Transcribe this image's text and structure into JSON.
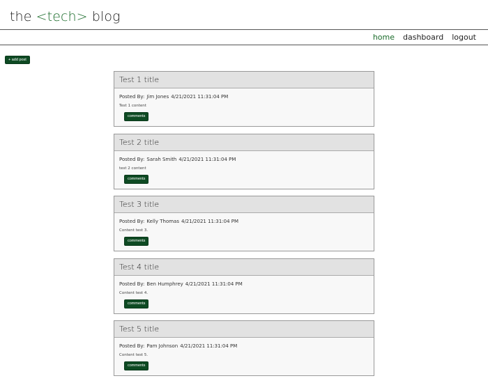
{
  "header": {
    "title_prefix": "the ",
    "title_accent": "<tech>",
    "title_suffix": " blog"
  },
  "nav": {
    "items": [
      {
        "label": "home",
        "active": true
      },
      {
        "label": "dashboard",
        "active": false
      },
      {
        "label": "logout",
        "active": false
      }
    ]
  },
  "toolbar": {
    "add_post_label": "+ add post"
  },
  "colors": {
    "accent": "#1a6b2a",
    "button": "#0e4a23",
    "card_header": "#e2e2e2"
  },
  "posts": [
    {
      "title": "Test 1 title",
      "posted_by_label": "Posted By:",
      "author": "Jim Jones",
      "date": "4/21/2021 11:31:04 PM",
      "content": "Test 1 content",
      "comments_label": "comments"
    },
    {
      "title": "Test 2 title",
      "posted_by_label": "Posted By:",
      "author": "Sarah Smith",
      "date": "4/21/2021 11:31:04 PM",
      "content": "test 2 content",
      "comments_label": "comments"
    },
    {
      "title": "Test 3 title",
      "posted_by_label": "Posted By:",
      "author": "Kelly Thomas",
      "date": "4/21/2021 11:31:04 PM",
      "content": "Content test 3.",
      "comments_label": "comments"
    },
    {
      "title": "Test 4 title",
      "posted_by_label": "Posted By:",
      "author": "Ben Humphrey",
      "date": "4/21/2021 11:31:04 PM",
      "content": "Content test 4.",
      "comments_label": "comments"
    },
    {
      "title": "Test 5 title",
      "posted_by_label": "Posted By:",
      "author": "Pam Johnson",
      "date": "4/21/2021 11:31:04 PM",
      "content": "Content test 5.",
      "comments_label": "comments"
    }
  ]
}
